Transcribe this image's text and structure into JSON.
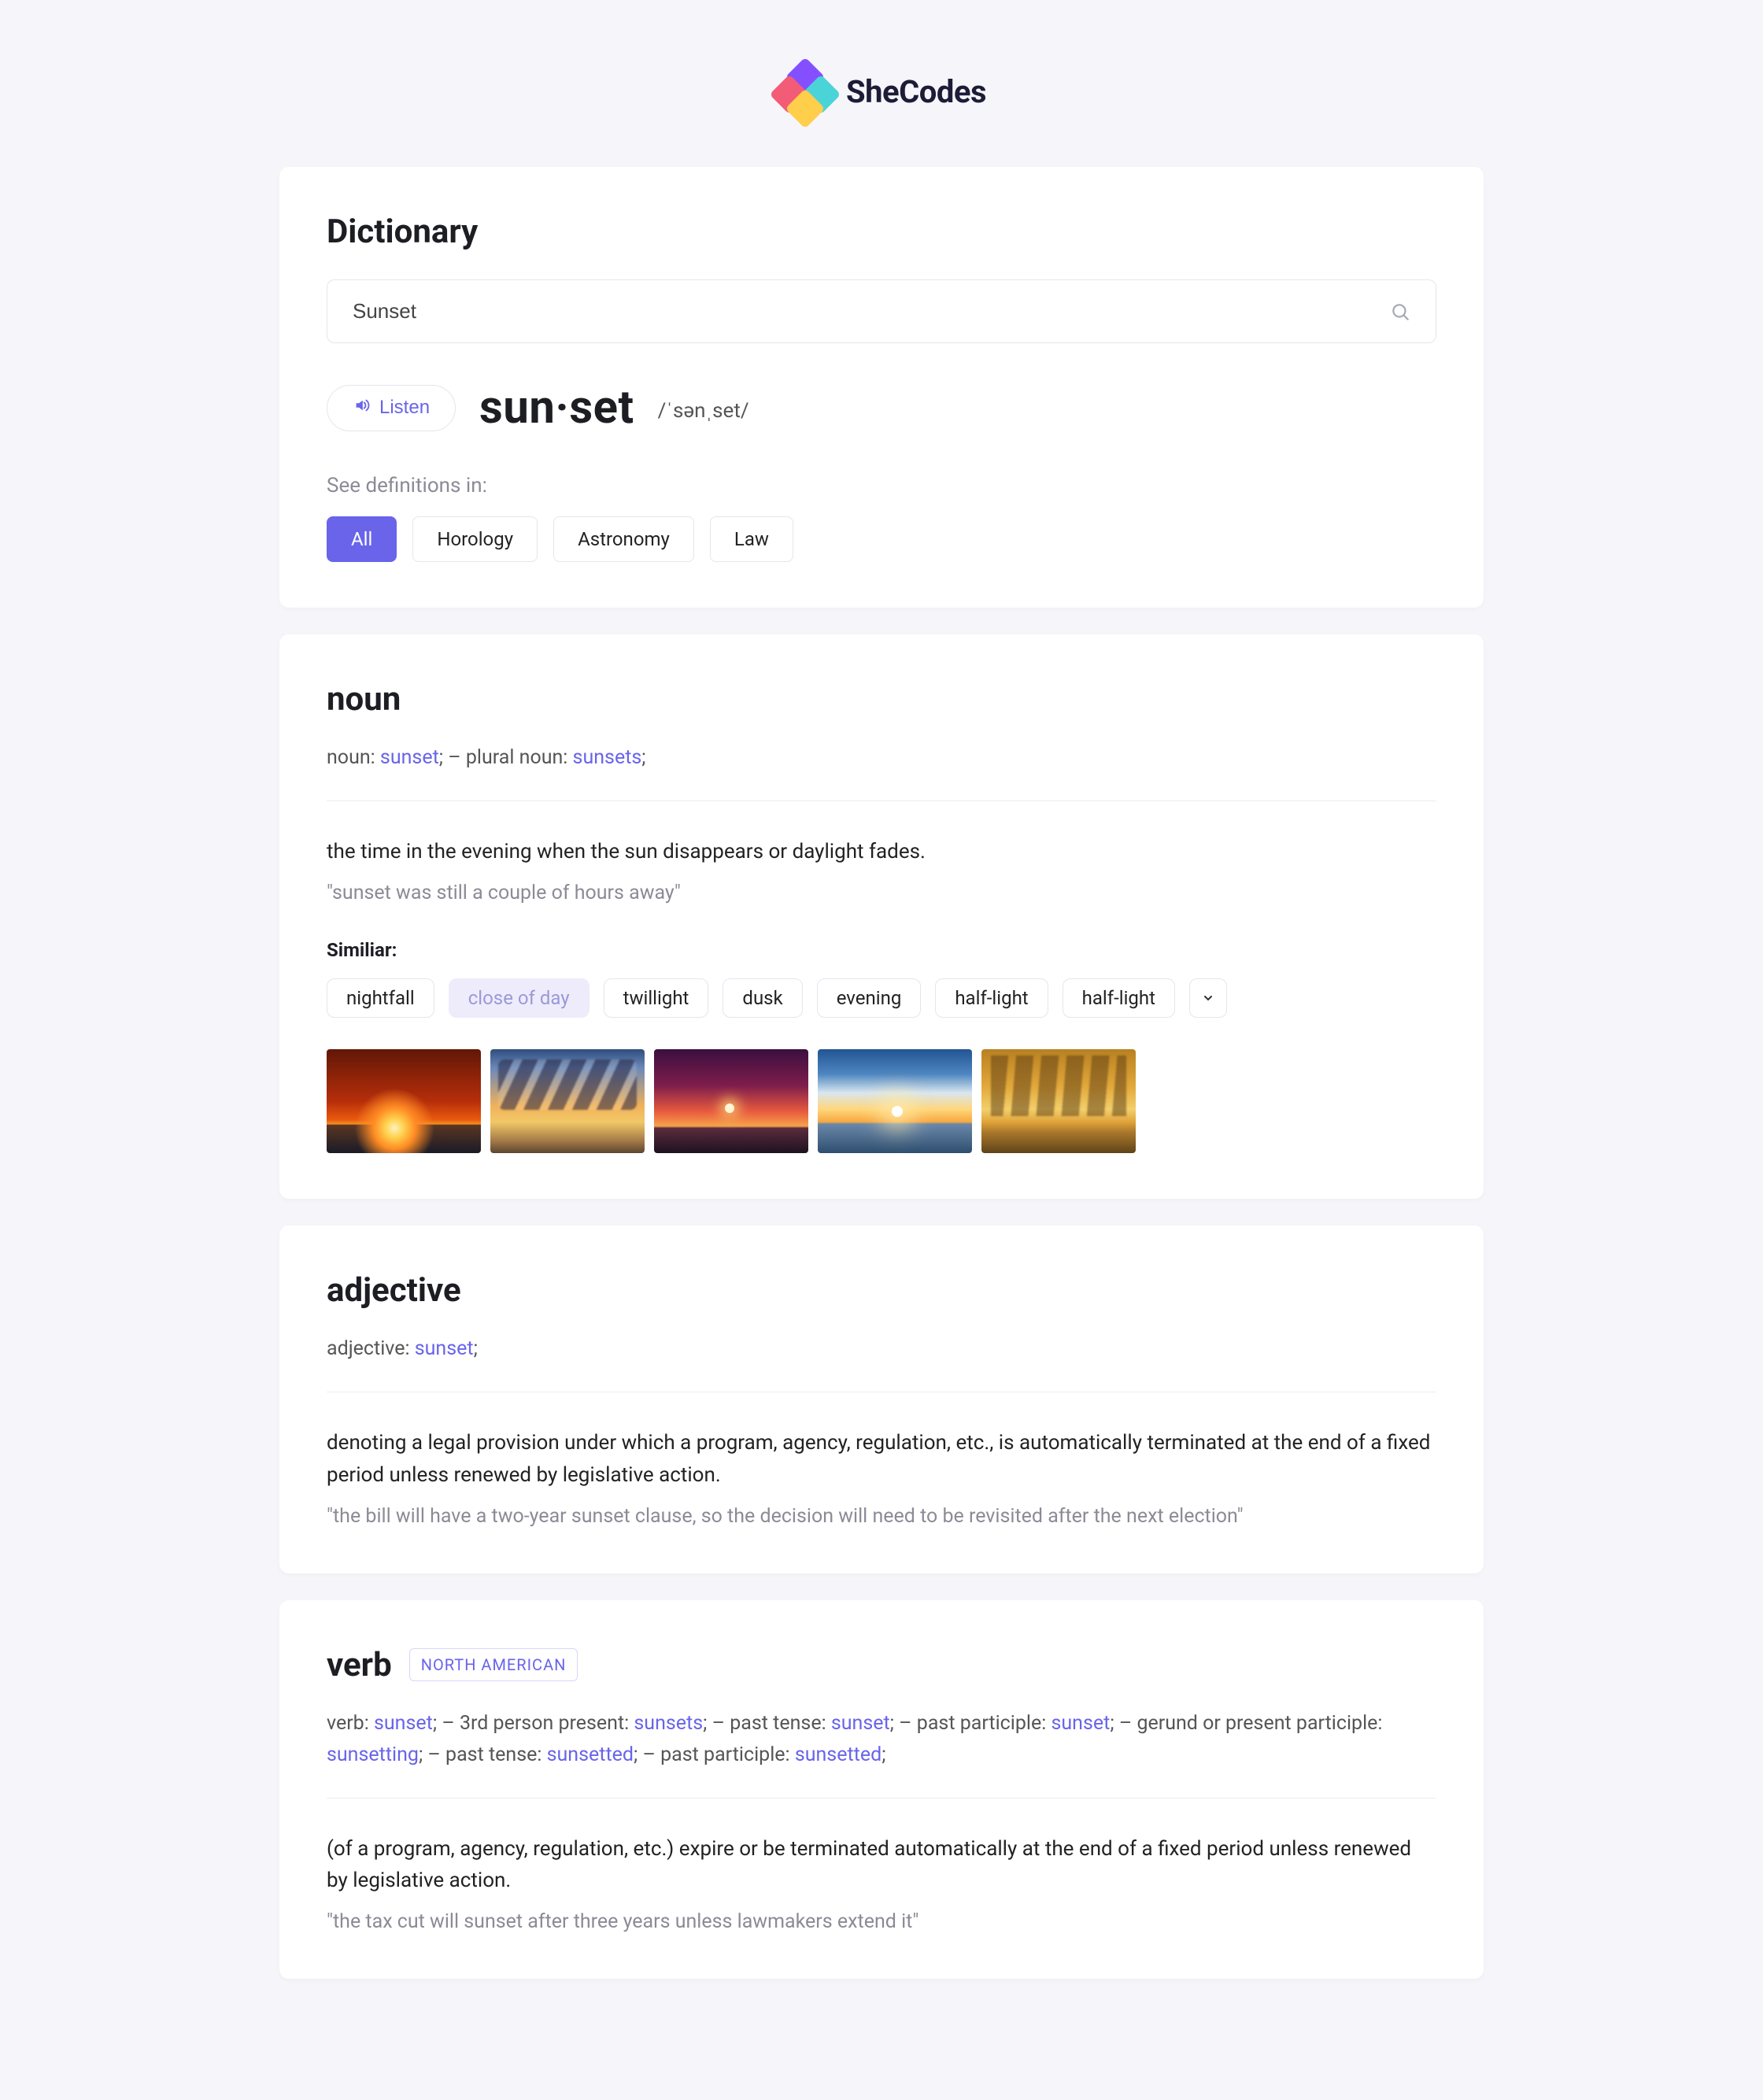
{
  "brand": "SheCodes",
  "header": {
    "title": "Dictionary",
    "search_value": "Sunset",
    "listen_label": "Listen",
    "headword": "sun·set",
    "phonetic": "/ˈsənˌset/",
    "see_definitions_label": "See definitions in:",
    "categories": [
      "All",
      "Horology",
      "Astronomy",
      "Law"
    ],
    "active_category": "All"
  },
  "noun": {
    "heading": "noun",
    "forms_pre1": "noun: ",
    "forms_link1": "sunset",
    "forms_sep": ";   –   ",
    "forms_pre2": "plural noun: ",
    "forms_link2": "sunsets",
    "definition": "the time in the evening when the sun disappears or daylight fades.",
    "example": "\"sunset was still a couple of hours away\"",
    "similar_label": "Similiar:",
    "similar": [
      "nightfall",
      "close of day",
      "twillight",
      "dusk",
      "evening",
      "half-light",
      "half-light"
    ],
    "similar_highlight_index": 1,
    "images": [
      "sunset-image-1",
      "sunset-image-2",
      "sunset-image-3",
      "sunset-image-4",
      "sunset-image-5"
    ]
  },
  "adjective": {
    "heading": "adjective",
    "forms_pre": "adjective: ",
    "forms_link": "sunset",
    "definition": "denoting a legal provision under which a program, agency, regulation, etc., is automatically terminated at the end of a fixed period unless renewed by legislative action.",
    "example": "\"the bill will have a two-year sunset clause, so the decision will need to be revisited after the next election\""
  },
  "verb": {
    "heading": "verb",
    "region_badge": "NORTH AMERICAN",
    "forms_parts": [
      {
        "label": "verb: ",
        "link": "sunset"
      },
      {
        "label": "3rd person present: ",
        "link": "sunsets"
      },
      {
        "label": "past tense: ",
        "link": "sunset"
      },
      {
        "label": "past participle: ",
        "link": "sunset"
      },
      {
        "label": "gerund or present participle: ",
        "link": "sunsetting"
      },
      {
        "label": "past tense: ",
        "link": "sunsetted"
      },
      {
        "label": "past participle: ",
        "link": "sunsetted"
      }
    ],
    "definition": "(of a program, agency, regulation, etc.) expire or be terminated automatically at the end of a fixed period unless renewed by legislative action.",
    "example": "\"the tax cut will sunset after three years unless lawmakers extend it\""
  }
}
